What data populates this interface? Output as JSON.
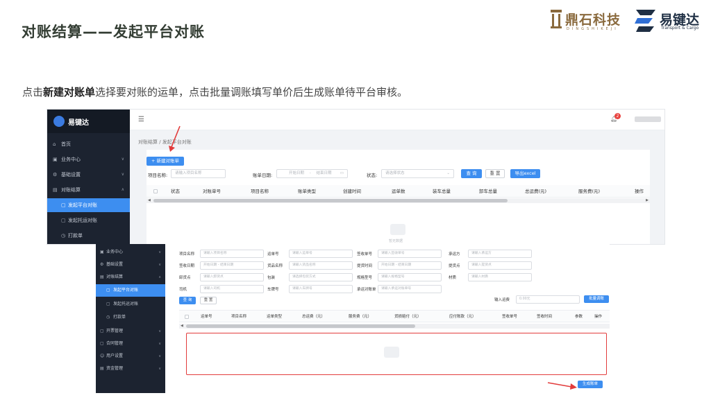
{
  "slide": {
    "title": "对账结算——发起平台对账",
    "description_pre": "点击",
    "description_bold": "新建对账单",
    "description_post": "选择要对账的运单，点击批量调账填写单价后生成账单待平台审核。",
    "logo1_name": "鼎石科技",
    "logo1_sub": "DINGSHIKEJI",
    "logo2_name": "易键达",
    "logo2_sub": "Transport & Cargo",
    "accent_red": "#e23b3b",
    "accent_blue": "#3d8ef0"
  },
  "app1": {
    "brand": "易键达",
    "sidebar": [
      {
        "label": "首页",
        "icon": "home-icon"
      },
      {
        "label": "业务中心",
        "icon": "grid-icon",
        "caret": "∨"
      },
      {
        "label": "基础设置",
        "icon": "gear-icon",
        "caret": "∨"
      },
      {
        "label": "对账结算",
        "icon": "wallet-icon",
        "caret": "∧"
      },
      {
        "label": "发起平台对账",
        "icon": "doc-icon",
        "active": true
      },
      {
        "label": "发起托运对账",
        "icon": "doc-icon"
      },
      {
        "label": "打款单",
        "icon": "clock-icon"
      }
    ],
    "breadcrumb": "对账结算 / 发起平台对账",
    "new_button": "+ 新建对账单",
    "badge_count": "2",
    "filters": {
      "project_label": "项目名称:",
      "project_placeholder": "请输入项目名称",
      "date_label": "账单日期:",
      "date_start": "开始日期",
      "date_sep": "-",
      "date_end": "结束日期",
      "status_label": "状态:",
      "status_placeholder": "请选择状态",
      "query": "查 询",
      "reset": "重 置",
      "export": "导出excel"
    },
    "columns": [
      "状态",
      "对账单号",
      "项目名称",
      "账单类型",
      "创建时间",
      "运单数",
      "装车总量",
      "卸车总量",
      "总运费(元)",
      "服务费(元)",
      "操作"
    ],
    "empty_text": "暂无数据"
  },
  "app2": {
    "sidebar": [
      {
        "label": "业务中心",
        "icon": "grid-icon",
        "caret": "∨"
      },
      {
        "label": "基础设置",
        "icon": "gear-icon",
        "caret": "∨"
      },
      {
        "label": "对账结算",
        "icon": "wallet-icon",
        "caret": "∧"
      },
      {
        "label": "发起平台对账",
        "icon": "doc-icon",
        "active": true
      },
      {
        "label": "发起托运对账",
        "icon": "doc-icon"
      },
      {
        "label": "打款单",
        "icon": "clock-icon"
      },
      {
        "label": "开票管理",
        "icon": "doc-icon",
        "caret": "∨"
      },
      {
        "label": "合同管理",
        "icon": "doc-icon",
        "caret": "∨"
      },
      {
        "label": "用户设置",
        "icon": "user-icon",
        "caret": "∨"
      },
      {
        "label": "资金管理",
        "icon": "wallet-icon",
        "caret": "∨"
      }
    ],
    "form_rows": [
      [
        {
          "label": "项目名称",
          "placeholder": "请输入项目名称"
        },
        {
          "label": "运单号",
          "placeholder": "请输入运单号"
        },
        {
          "label": "签收单号",
          "placeholder": "请输入签收单号"
        },
        {
          "label": "承运方",
          "placeholder": "请输入承运方"
        }
      ],
      [
        {
          "label": "签收日期",
          "placeholder": "开始日期  -  结束日期"
        },
        {
          "label": "货品名称",
          "placeholder": "请输入货品名称"
        },
        {
          "label": "提货时间",
          "placeholder": "开始日期  -  结束日期"
        },
        {
          "label": "提货点",
          "placeholder": "请输入提货点"
        }
      ],
      [
        {
          "label": "卸货点",
          "placeholder": "请输入卸货点"
        },
        {
          "label": "包装",
          "placeholder": "请选择包装方式"
        },
        {
          "label": "规格型号",
          "placeholder": "请输入规格型号"
        },
        {
          "label": "材质",
          "placeholder": "请输入材质"
        }
      ],
      [
        {
          "label": "司机",
          "placeholder": "请输入司机"
        },
        {
          "label": "车牌号",
          "placeholder": "请输入车牌号"
        },
        {
          "label": "承运对账单",
          "placeholder": "请输入承运对账单号"
        }
      ]
    ],
    "query": "查 询",
    "reset": "重 置",
    "freight_label": "输入运费",
    "freight_placeholder": "0.00元",
    "batch_adjust": "批量调账",
    "columns": [
      "运单号",
      "项目名称",
      "运单类型",
      "总运费（元）",
      "服务费（元）",
      "货损赔付（元）",
      "应付账款（元）",
      "签收单号",
      "签收时间",
      "参数",
      "操作"
    ],
    "generate_button": "生成账单"
  }
}
